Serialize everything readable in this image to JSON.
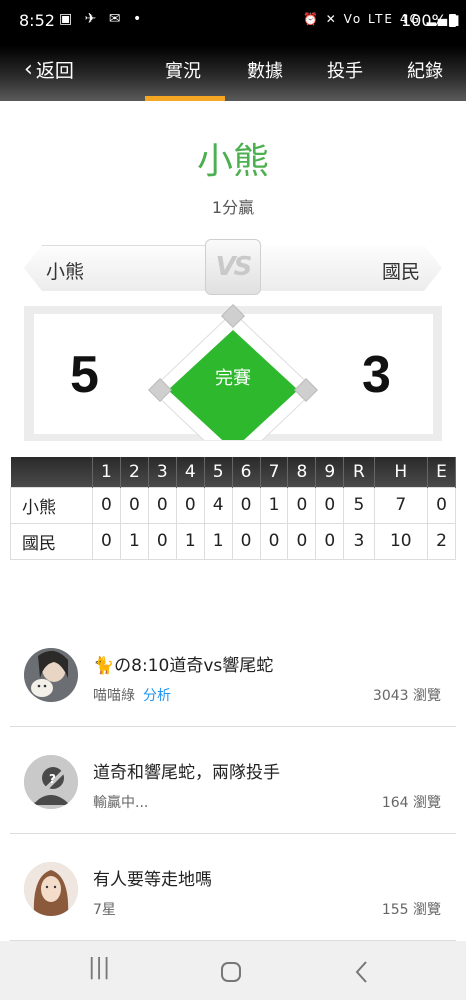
{
  "status_bar": {
    "time": "8:52",
    "battery": "100%"
  },
  "nav": {
    "back_label": "返回",
    "tabs": [
      "實況",
      "數據",
      "投手",
      "紀錄"
    ],
    "active_tab": 0
  },
  "winner": {
    "team": "小熊",
    "margin_text": "1分贏"
  },
  "matchup": {
    "away_team": "小熊",
    "home_team": "國民",
    "vs_label": "VS"
  },
  "score": {
    "away": "5",
    "home": "3",
    "status": "完賽"
  },
  "linescore": {
    "headers": [
      "1",
      "2",
      "3",
      "4",
      "5",
      "6",
      "7",
      "8",
      "9",
      "R",
      "H",
      "E"
    ],
    "rows": [
      {
        "team": "小熊",
        "values": [
          "0",
          "0",
          "0",
          "0",
          "4",
          "0",
          "1",
          "0",
          "0",
          "5",
          "7",
          "0"
        ]
      },
      {
        "team": "國民",
        "values": [
          "0",
          "1",
          "0",
          "1",
          "1",
          "0",
          "0",
          "0",
          "0",
          "3",
          "10",
          "2"
        ]
      }
    ]
  },
  "posts": [
    {
      "title": "🐈の8:10道奇vs響尾蛇",
      "author": "喵喵綠",
      "tag": "分析",
      "views": "3043 瀏覽"
    },
    {
      "title": "道奇和響尾蛇，兩隊投手",
      "author": "輸贏中...",
      "tag": "",
      "views": "164 瀏覽"
    },
    {
      "title": "有人要等走地嗎",
      "author": "7星",
      "tag": "",
      "views": "155 瀏覽"
    }
  ],
  "colors": {
    "accent": "#f5a623",
    "winner_green": "#4caf50",
    "diamond_green": "#2db82d",
    "link_blue": "#2196f3"
  }
}
